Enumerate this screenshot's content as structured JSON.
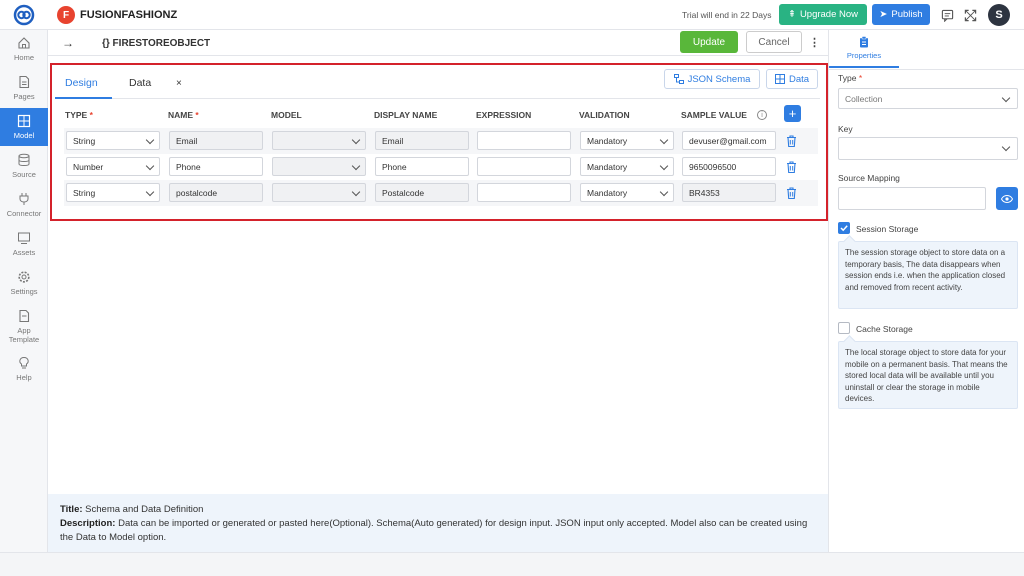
{
  "header": {
    "app_badge": "F",
    "app_name": "FUSIONFASHIONZ",
    "trial_text": "Trial will end in 22 Days",
    "upgrade_label": "Upgrade Now",
    "publish_label": "Publish",
    "avatar_initial": "S"
  },
  "sidebar": {
    "items": [
      {
        "label": "Home",
        "icon": "home-icon"
      },
      {
        "label": "Pages",
        "icon": "page-icon"
      },
      {
        "label": "Model",
        "icon": "table-icon",
        "active": true
      },
      {
        "label": "Source",
        "icon": "database-icon"
      },
      {
        "label": "Connector",
        "icon": "plug-icon"
      },
      {
        "label": "Assets",
        "icon": "monitor-icon"
      },
      {
        "label": "Settings",
        "icon": "gear-icon"
      },
      {
        "label": "App",
        "label2": "Template",
        "icon": "file-icon"
      },
      {
        "label": "Help",
        "icon": "bulb-icon"
      }
    ]
  },
  "subheader": {
    "back": "→",
    "title": "{} FIRESTOREOBJECT",
    "update_label": "Update",
    "cancel_label": "Cancel",
    "more": "⋮"
  },
  "tabs": {
    "design": "Design",
    "data": "Data",
    "close": "×",
    "json_schema_label": "JSON Schema",
    "data_button_label": "Data"
  },
  "table": {
    "headers": {
      "type": "TYPE",
      "name": "NAME",
      "model": "MODEL",
      "display_name": "DISPLAY NAME",
      "expression": "EXPRESSION",
      "validation": "VALIDATION",
      "sample_value": "SAMPLE VALUE",
      "required_mark": "*",
      "info": "i",
      "add": "+"
    },
    "rows": [
      {
        "type": "String",
        "name": "Email",
        "model": "",
        "display_name": "Email",
        "expression": "",
        "validation": "Mandatory",
        "sample_value": "devuser@gmail.com"
      },
      {
        "type": "Number",
        "name": "Phone",
        "model": "",
        "display_name": "Phone",
        "expression": "",
        "validation": "Mandatory",
        "sample_value": "9650096500"
      },
      {
        "type": "String",
        "name": "postalcode",
        "model": "",
        "display_name": "Postalcode",
        "expression": "",
        "validation": "Mandatory",
        "sample_value": "BR4353"
      }
    ]
  },
  "info": {
    "title_label": "Title:",
    "title_text": " Schema and Data Definition",
    "desc_label": "Description:",
    "desc_text": " Data can be imported or generated or pasted here(Optional). Schema(Auto generated) for design input. JSON input only accepted. Model also can be created using the Data to Model option."
  },
  "properties": {
    "tab_label": "Properties",
    "type_label": "Type",
    "type_required": "*",
    "type_value": "Collection",
    "key_label": "Key",
    "key_value": "",
    "source_mapping_label": "Source Mapping",
    "session_storage_label": "Session Storage",
    "session_storage_checked": true,
    "session_storage_desc": "The session storage object to store data on a temporary basis, The data disappears when session ends i.e. when the application closed and removed from recent activity.",
    "cache_storage_label": "Cache Storage",
    "cache_storage_checked": false,
    "cache_storage_desc": "The local storage object to store data for your mobile on a permanent basis. That means the stored local data will be available until you uninstall or clear the storage in mobile devices."
  },
  "colors": {
    "accent": "#2f7de1",
    "upgrade": "#29b383",
    "update": "#59b73a",
    "highlight_border": "#d4222b",
    "badge": "#e8432f"
  }
}
